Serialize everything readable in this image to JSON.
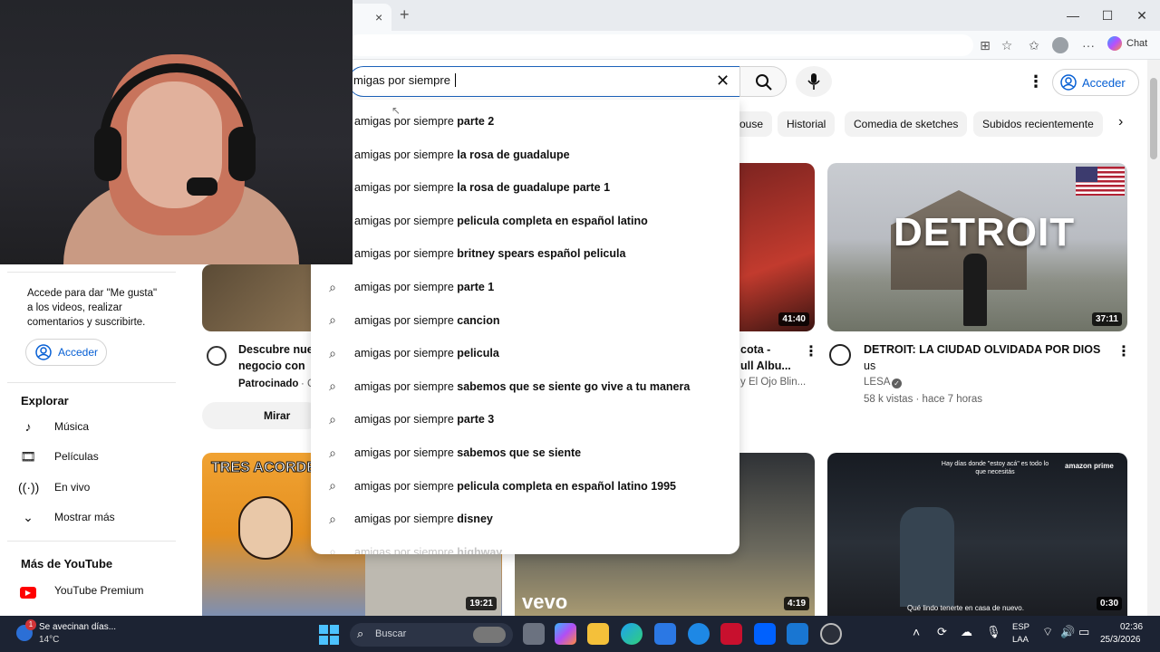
{
  "browser": {
    "tab_close": "×",
    "new_tab": "+",
    "copilot_label": "Chat",
    "window_min": "—",
    "window_max": "☐",
    "window_close": "✕"
  },
  "youtube": {
    "search_value": "migas por siempre ",
    "sign_in": "Acceder",
    "chips": [
      "ouse",
      "Historial",
      "Comedia de sketches",
      "Subidos recientemente"
    ]
  },
  "suggestions": [
    {
      "pre": "amigas por siempre ",
      "post": "parte 2"
    },
    {
      "pre": "amigas por siempre ",
      "post": "la rosa de guadalupe"
    },
    {
      "pre": "amigas por siempre ",
      "post": "la rosa de guadalupe parte 1"
    },
    {
      "pre": "amigas por siempre ",
      "post": "pelicula completa en español latino"
    },
    {
      "pre": "amigas por siempre ",
      "post": "britney spears español pelicula"
    },
    {
      "pre": "amigas por siempre ",
      "post": "parte 1"
    },
    {
      "pre": "amigas por siempre ",
      "post": "cancion"
    },
    {
      "pre": "amigas por siempre ",
      "post": "pelicula"
    },
    {
      "pre": "amigas por siempre ",
      "post": "sabemos que se siente go vive a tu manera"
    },
    {
      "pre": "amigas por siempre ",
      "post": "parte 3"
    },
    {
      "pre": "amigas por siempre ",
      "post": "sabemos que se siente"
    },
    {
      "pre": "amigas por siempre ",
      "post": "pelicula completa en español latino 1995"
    },
    {
      "pre": "amigas por siempre ",
      "post": "disney"
    },
    {
      "pre": "amigas por siempre ",
      "post": "highway"
    }
  ],
  "sidebar": {
    "signin_prompt": "Accede para dar \"Me gusta\" a los videos, realizar comentarios y suscribirte.",
    "signin_button": "Acceder",
    "explore_heading": "Explorar",
    "explore_items": [
      {
        "icon": "music-icon",
        "label": "Música"
      },
      {
        "icon": "movies-icon",
        "label": "Películas"
      },
      {
        "icon": "live-icon",
        "label": "En vivo"
      },
      {
        "icon": "chevron-down-icon",
        "label": "Mostrar más"
      }
    ],
    "more_heading": "Más de YouTube",
    "more_items": [
      {
        "icon": "youtube-premium-icon",
        "label": "YouTube Premium"
      }
    ]
  },
  "videos": {
    "ad": {
      "title_visible": "Descubre nue",
      "title_line2": "negocio con",
      "sponsored": "Patrocinado",
      "sponsored_sep": "· C",
      "cta": "Mirar"
    },
    "middle": {
      "duration": "41:40",
      "title_frag1": "cota -",
      "title_frag2": "ull Albu...",
      "channel_frag": "y El Ojo Blin..."
    },
    "detroit": {
      "thumb_text": "DETROIT",
      "duration": "37:11",
      "title": "DETROIT: LA CIUDAD OLVIDADA POR DIOS",
      "title_line2": "us",
      "channel": "LESA",
      "meta": "58 k vistas · hace 7 horas"
    },
    "row2": [
      {
        "thumb_text": "TRES ACORDE",
        "duration": "19:21"
      },
      {
        "thumb_text": "vevo",
        "duration": "4:19"
      },
      {
        "badge_top": "Hay días donde \"estoy acá\" es todo lo que necesitás",
        "brand": "amazon prime",
        "caption": "Qué lindo tenerte en casa de nuevo.",
        "duration": "0:30"
      }
    ]
  },
  "taskbar": {
    "weather_title": "Se avecinan días...",
    "weather_temp": "14°C",
    "weather_badge": "1",
    "search_placeholder": "Buscar",
    "lang_top": "ESP",
    "lang_bottom": "LAA",
    "time": "02:36",
    "date": "25/3/2026"
  },
  "colors": {
    "accent_blue": "#065fd4",
    "taskbar_bg": "#1c2333",
    "yt_red": "#ff0000"
  }
}
